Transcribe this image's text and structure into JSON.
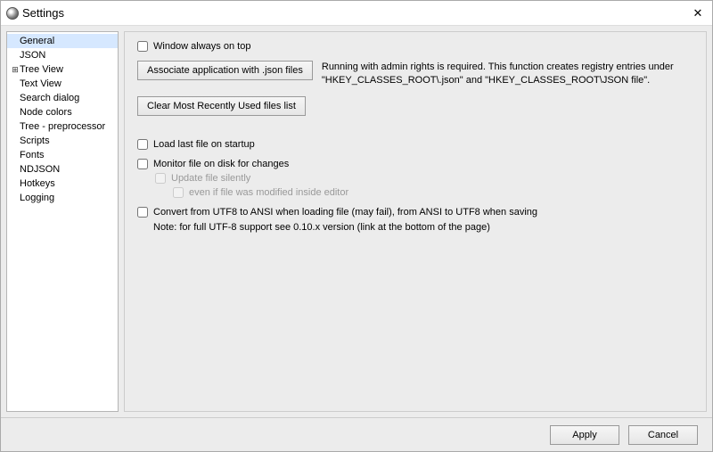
{
  "window": {
    "title": "Settings"
  },
  "sidebar": {
    "items": [
      {
        "label": "General",
        "selected": true
      },
      {
        "label": "JSON"
      },
      {
        "label": "Tree View",
        "expandable": true
      },
      {
        "label": "Text View"
      },
      {
        "label": "Search dialog"
      },
      {
        "label": "Node colors"
      },
      {
        "label": "Tree - preprocessor"
      },
      {
        "label": "Scripts"
      },
      {
        "label": "Fonts"
      },
      {
        "label": "NDJSON"
      },
      {
        "label": "Hotkeys"
      },
      {
        "label": "Logging"
      }
    ]
  },
  "content": {
    "alwaysOnTop": {
      "label": "Window always on top",
      "checked": false
    },
    "associateBtn": "Associate application with .json files",
    "associateNote": "Running with admin rights is required. This function creates registry entries under \"HKEY_CLASSES_ROOT\\.json\" and \"HKEY_CLASSES_ROOT\\JSON file\".",
    "clearMruBtn": "Clear Most Recently Used files list",
    "loadLast": {
      "label": "Load last file on startup",
      "checked": false
    },
    "monitor": {
      "label": "Monitor file on disk for changes",
      "checked": false
    },
    "updateSilently": {
      "label": "Update file silently",
      "checked": false
    },
    "evenIfModified": {
      "label": "even if file was modified inside editor",
      "checked": false
    },
    "convertUtf": {
      "label": "Convert from UTF8 to ANSI when loading file (may fail), from ANSI to UTF8 when saving",
      "checked": false
    },
    "utfNote": "Note: for full UTF-8 support see 0.10.x version (link at the bottom of the page)"
  },
  "footer": {
    "apply": "Apply",
    "cancel": "Cancel"
  }
}
